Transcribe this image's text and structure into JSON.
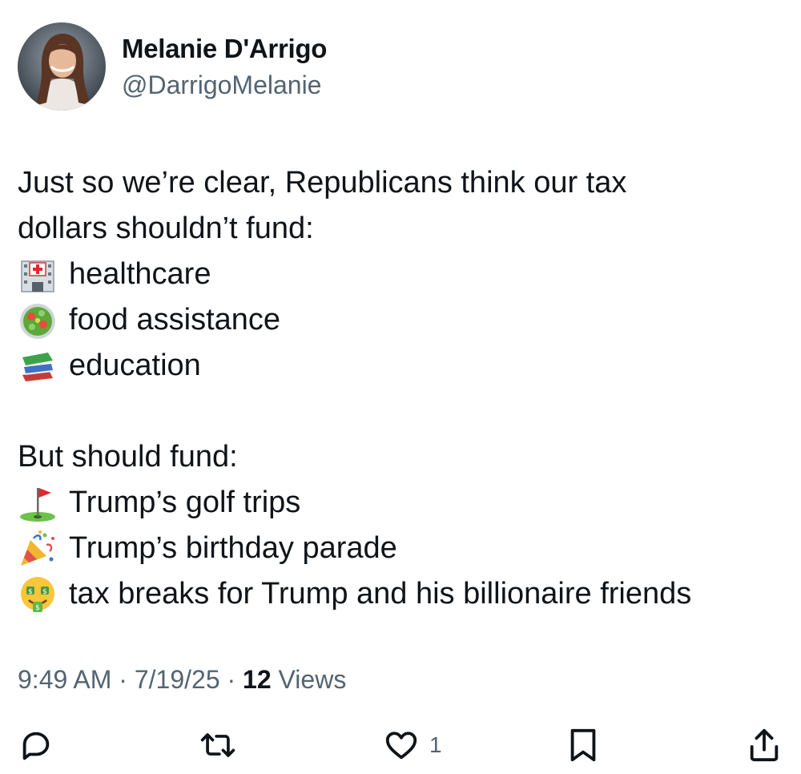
{
  "author": {
    "name": "Melanie D'Arrigo",
    "handle": "@DarrigoMelanie"
  },
  "tweet": {
    "intro_line1": "Just so we’re clear, Republicans think our tax",
    "intro_line2": "dollars shouldn’t fund:",
    "shouldnt_fund": [
      {
        "icon": "hospital-icon",
        "text": "healthcare"
      },
      {
        "icon": "salad-icon",
        "text": "food assistance"
      },
      {
        "icon": "books-icon",
        "text": "education"
      }
    ],
    "but_line": "But should fund:",
    "should_fund": [
      {
        "icon": "golf-flag-icon",
        "text": "Trump’s golf trips"
      },
      {
        "icon": "party-popper-icon",
        "text": "Trump’s birthday parade"
      },
      {
        "icon": "money-mouth-face-icon",
        "text": "tax breaks for Trump and his billionaire friends"
      }
    ]
  },
  "meta": {
    "time": "9:49 AM",
    "separator": "·",
    "date": "7/19/25",
    "views_count": "12",
    "views_label": "Views"
  },
  "actions": {
    "reply_count": "",
    "retweet_count": "",
    "like_count": "1",
    "bookmark_count": ""
  },
  "colors": {
    "text": "#0f1419",
    "secondary": "#536471",
    "background": "#ffffff"
  }
}
